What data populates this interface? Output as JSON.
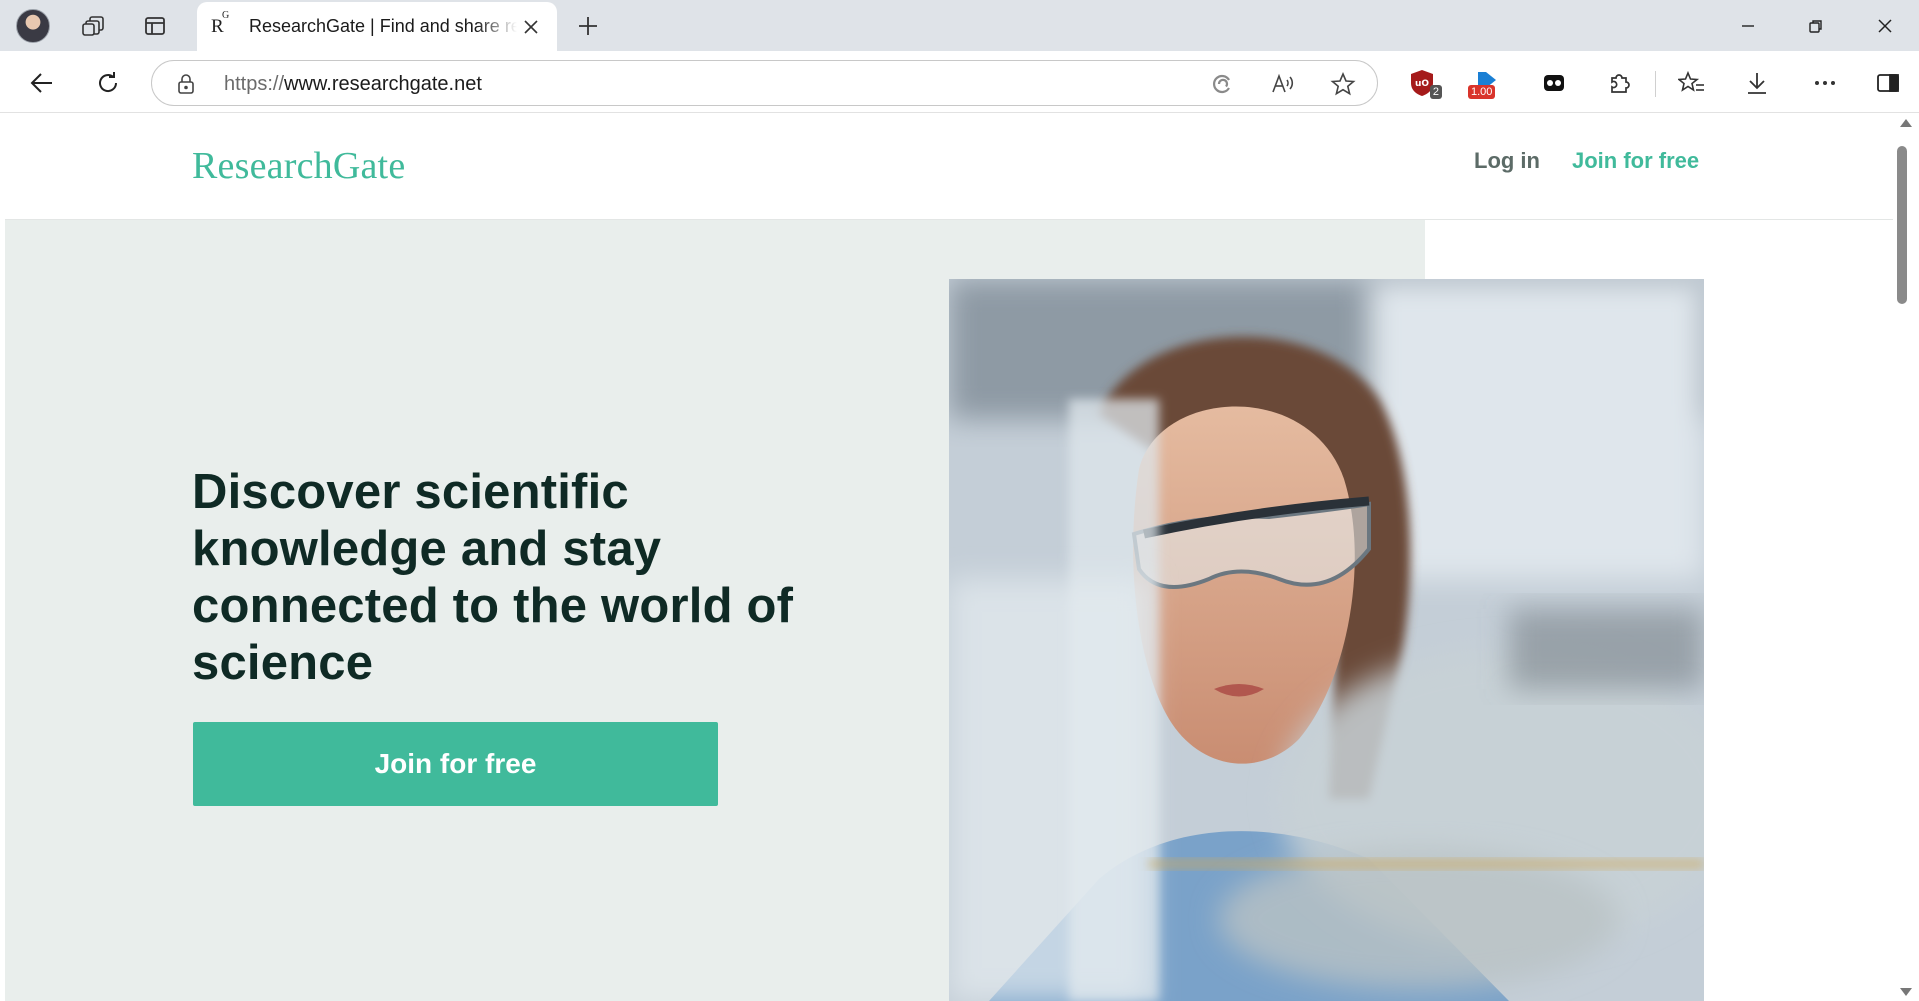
{
  "browser": {
    "tab": {
      "favicon": "R",
      "favicon_sup": "G",
      "title": "ResearchGate | Find and share research"
    },
    "address": {
      "scheme": "https://",
      "host": "www.researchgate.net"
    },
    "extensions": {
      "ublock_badge": "2",
      "counter_badge": "1.00"
    }
  },
  "site": {
    "logo": "ResearchGate",
    "nav": {
      "login": "Log in",
      "join": "Join for free"
    },
    "hero": {
      "headline": "Discover scientific knowledge and stay connected to the world of science",
      "cta": "Join for free"
    }
  },
  "colors": {
    "brand": "#40ba9b",
    "hero_bg": "#e9eeec",
    "headline": "#0f2a25"
  }
}
